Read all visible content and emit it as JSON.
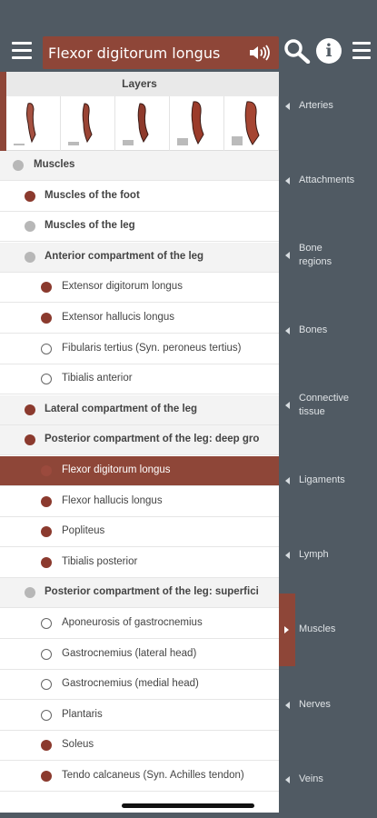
{
  "header": {
    "title": "Flexor digitorum longus",
    "icons": [
      "menu-icon",
      "speaker-icon",
      "search-icon",
      "info-icon",
      "menu-icon"
    ],
    "info_glyph": "i"
  },
  "layers": {
    "title": "Layers",
    "thumbnails": [
      "layer-1",
      "layer-2",
      "layer-3",
      "layer-4",
      "layer-5"
    ]
  },
  "tree": [
    {
      "label": "Muscles",
      "level": 0,
      "dot": "grey",
      "bold": true,
      "style": "gray"
    },
    {
      "label": "Muscles of the foot",
      "level": 1,
      "dot": "red",
      "bold": true,
      "style": "white"
    },
    {
      "label": "Muscles of the leg",
      "level": 1,
      "dot": "grey",
      "bold": true,
      "style": "white"
    },
    {
      "label": "Anterior compartment of the leg",
      "level": 2,
      "dot": "grey",
      "bold": true,
      "style": "gray"
    },
    {
      "label": "Extensor digitorum longus",
      "level": 3,
      "dot": "red",
      "bold": false,
      "style": "white"
    },
    {
      "label": "Extensor hallucis longus",
      "level": 3,
      "dot": "red",
      "bold": false,
      "style": "white"
    },
    {
      "label": "Fibularis tertius (Syn. peroneus tertius)",
      "level": 3,
      "dot": "open",
      "bold": false,
      "style": "white"
    },
    {
      "label": "Tibialis anterior",
      "level": 3,
      "dot": "open",
      "bold": false,
      "style": "white"
    },
    {
      "label": "Lateral compartment of the leg",
      "level": 2,
      "dot": "red",
      "bold": true,
      "style": "gray"
    },
    {
      "label": "Posterior compartment of the leg: deep gro",
      "level": 2,
      "dot": "red",
      "bold": true,
      "style": "gray"
    },
    {
      "label": "Flexor digitorum longus",
      "level": 3,
      "dot": "red",
      "bold": false,
      "style": "selected"
    },
    {
      "label": "Flexor hallucis longus",
      "level": 3,
      "dot": "red",
      "bold": false,
      "style": "white"
    },
    {
      "label": "Popliteus",
      "level": 3,
      "dot": "red",
      "bold": false,
      "style": "white"
    },
    {
      "label": "Tibialis posterior",
      "level": 3,
      "dot": "red",
      "bold": false,
      "style": "white"
    },
    {
      "label": "Posterior compartment of the leg: superfici",
      "level": 2,
      "dot": "grey",
      "bold": true,
      "style": "gray"
    },
    {
      "label": "Aponeurosis of gastrocnemius",
      "level": 3,
      "dot": "open",
      "bold": false,
      "style": "white"
    },
    {
      "label": "Gastrocnemius (lateral head)",
      "level": 3,
      "dot": "open",
      "bold": false,
      "style": "white"
    },
    {
      "label": "Gastrocnemius (medial head)",
      "level": 3,
      "dot": "open",
      "bold": false,
      "style": "white"
    },
    {
      "label": "Plantaris",
      "level": 3,
      "dot": "open",
      "bold": false,
      "style": "white"
    },
    {
      "label": "Soleus",
      "level": 3,
      "dot": "red",
      "bold": false,
      "style": "white"
    },
    {
      "label": "Tendo calcaneus (Syn. Achilles tendon)",
      "level": 3,
      "dot": "red",
      "bold": false,
      "style": "white"
    }
  ],
  "nav": {
    "items": [
      {
        "label": "Arteries",
        "active": false
      },
      {
        "label": "Attachments",
        "active": false
      },
      {
        "label": "Bone regions",
        "active": false
      },
      {
        "label": "Bones",
        "active": false
      },
      {
        "label": "Connective tissue",
        "active": false
      },
      {
        "label": "Ligaments",
        "active": false
      },
      {
        "label": "Lymph",
        "active": false
      },
      {
        "label": "Muscles",
        "active": true
      },
      {
        "label": "Nerves",
        "active": false
      },
      {
        "label": "Veins",
        "active": false
      }
    ]
  },
  "colors": {
    "accent": "#8e4638",
    "sidebar": "#505a63",
    "muscle_dot": "#8b3a2e",
    "group_dot": "#b7b7b7"
  }
}
